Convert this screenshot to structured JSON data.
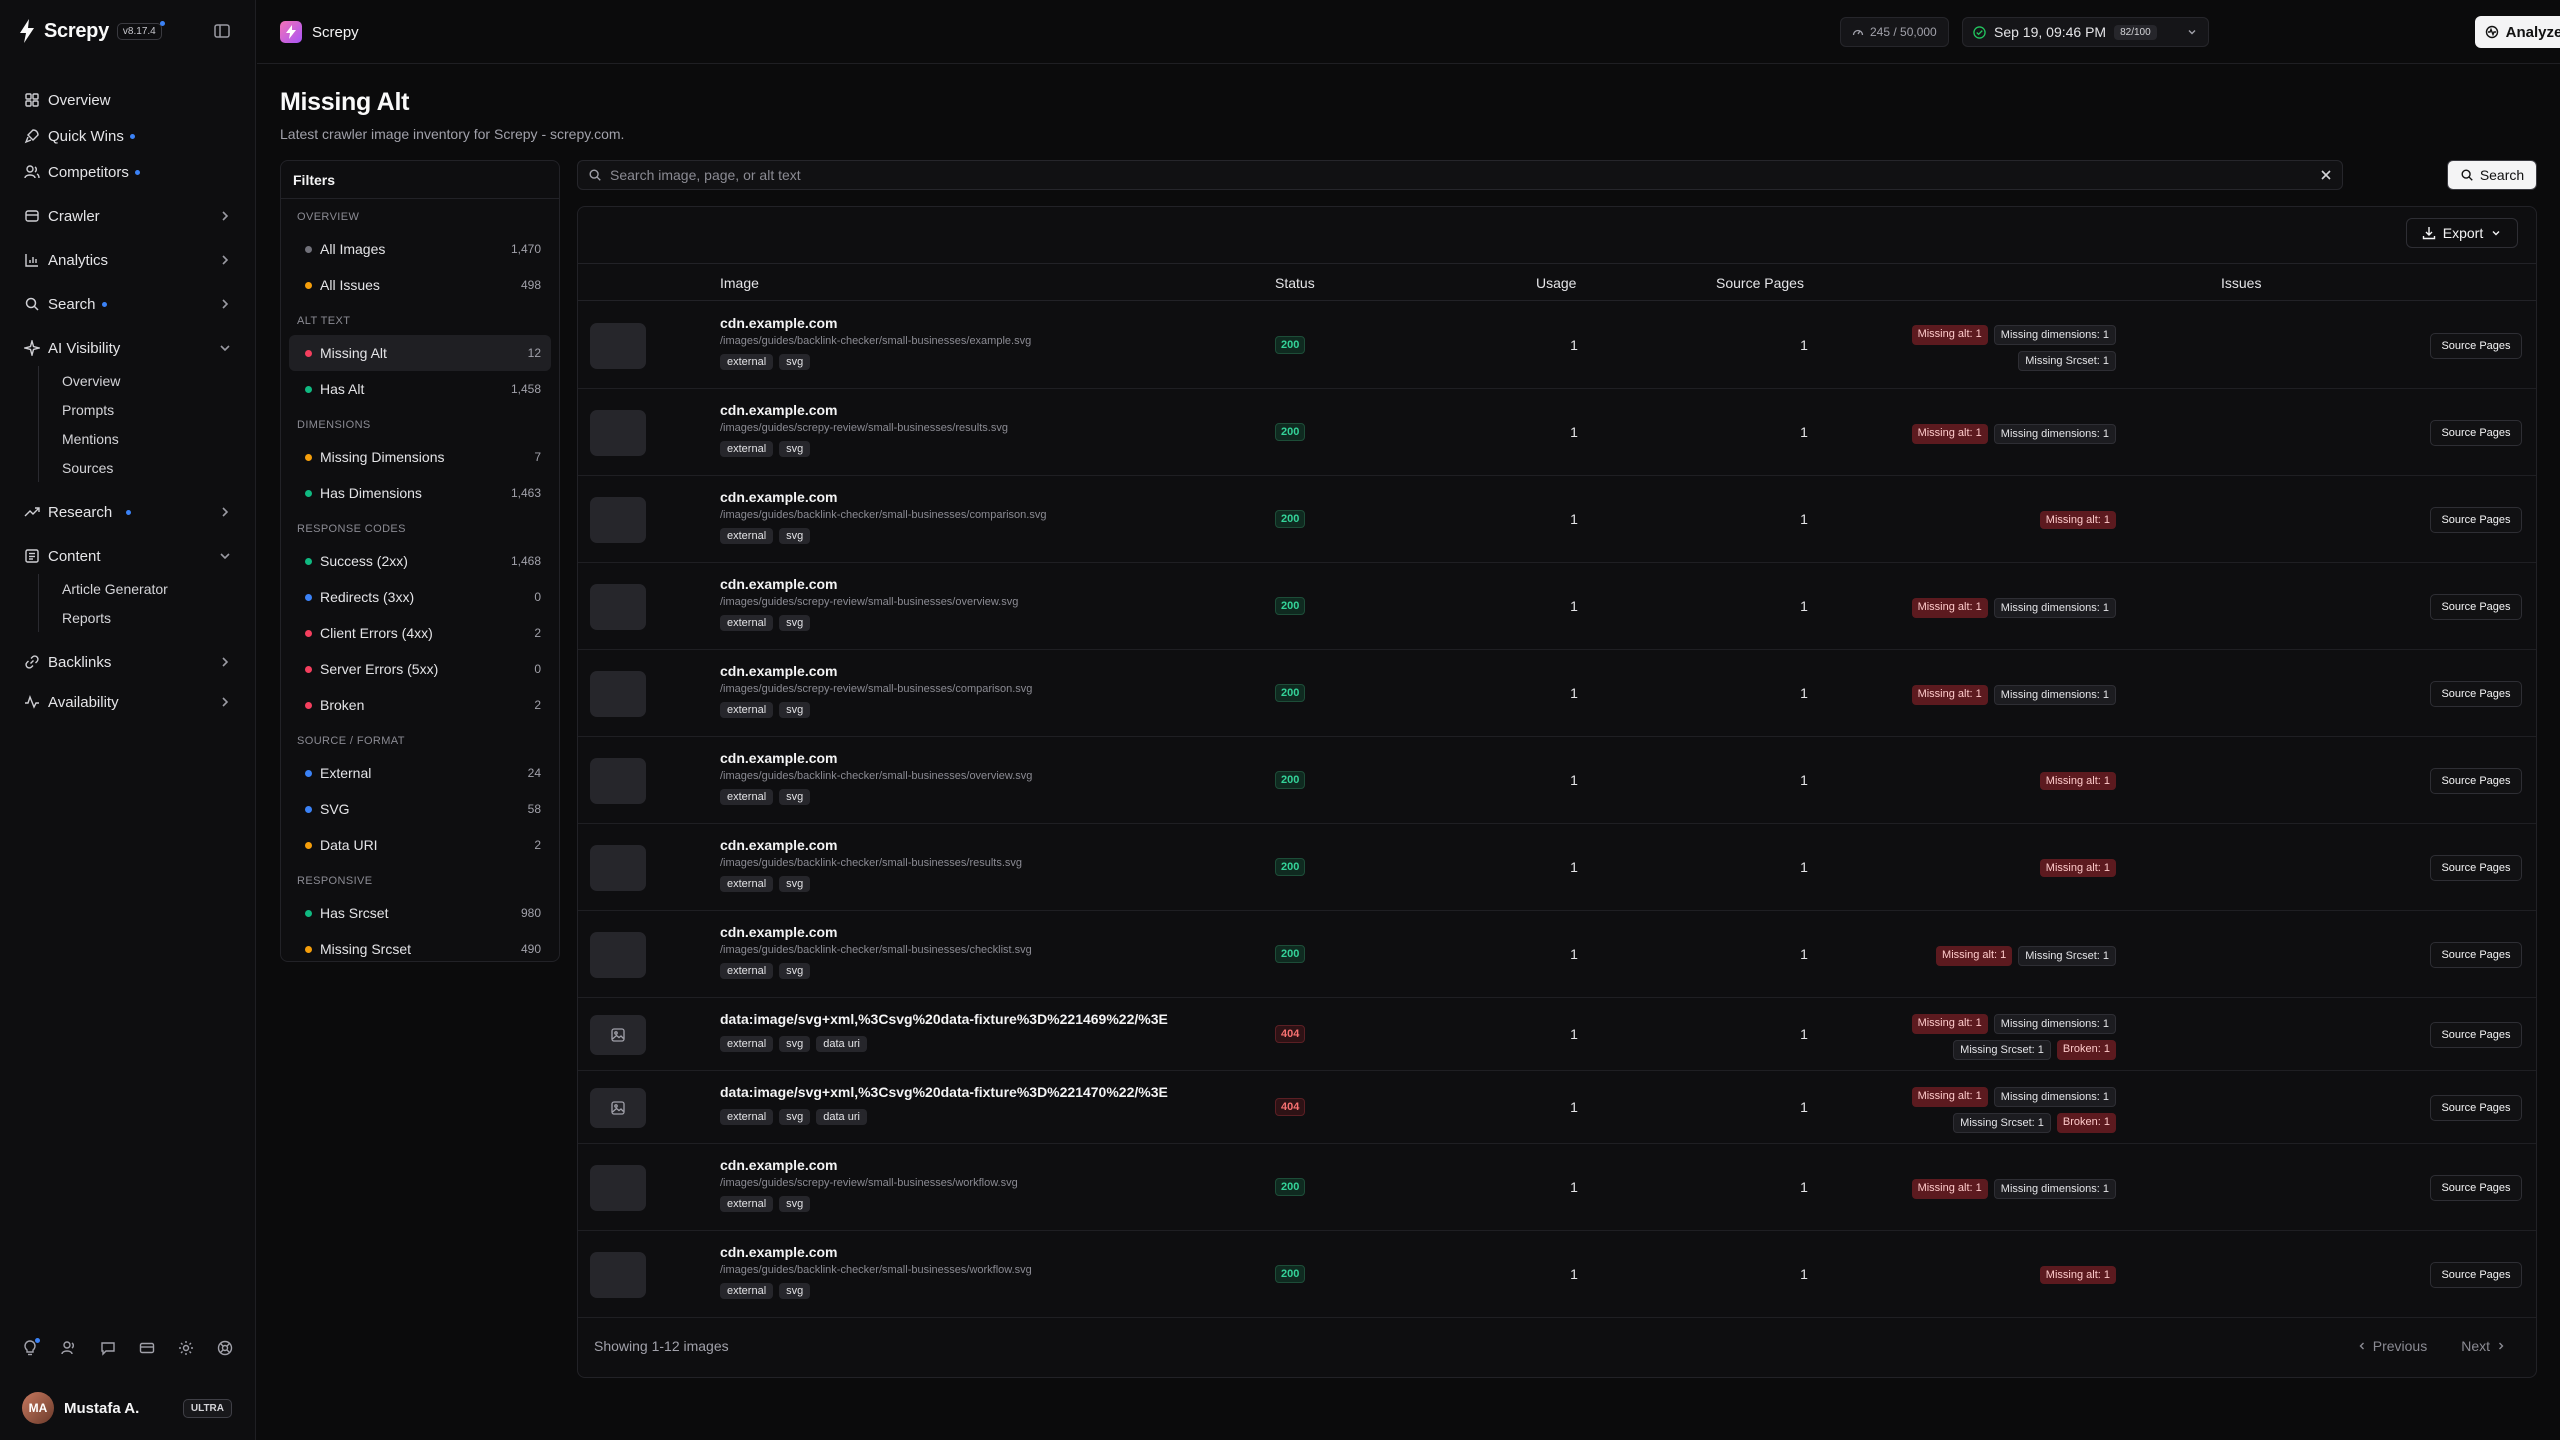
{
  "app": {
    "name": "Screpy",
    "version": "v8.17.4"
  },
  "sidebar": {
    "items": [
      {
        "label": "Overview",
        "icon": "grid-icon"
      },
      {
        "label": "Quick Wins",
        "icon": "rocket-icon",
        "dot": true
      },
      {
        "label": "Competitors",
        "icon": "users-icon",
        "dot": true
      },
      {
        "label": "Crawler",
        "icon": "wallet-icon",
        "chevron": "right"
      },
      {
        "label": "Analytics",
        "icon": "bar-chart-icon",
        "chevron": "right"
      },
      {
        "label": "Search",
        "icon": "search-icon",
        "chevron": "right",
        "dot": true
      },
      {
        "label": "AI Visibility",
        "icon": "sparkle-icon",
        "chevron": "down"
      },
      {
        "label": "Research",
        "icon": "trending-icon",
        "chevron": "right",
        "dot": true
      },
      {
        "label": "Content",
        "icon": "newspaper-icon",
        "chevron": "down"
      },
      {
        "label": "Backlinks",
        "icon": "link-icon",
        "chevron": "right"
      },
      {
        "label": "Availability",
        "icon": "activity-icon",
        "chevron": "right"
      }
    ],
    "ai_visibility_sub": [
      "Overview",
      "Prompts",
      "Mentions",
      "Sources"
    ],
    "content_sub": [
      "Article Generator",
      "Reports"
    ],
    "user": {
      "name": "Mustafa A.",
      "initials": "MA",
      "plan": "ULTRA"
    }
  },
  "topbar": {
    "project": "Screpy",
    "credits": "245 / 50,000",
    "date": "Sep 19, 09:46 PM",
    "score": "82/100",
    "analyze": "Analyze"
  },
  "page": {
    "title": "Missing Alt",
    "subtitle": "Latest crawler image inventory for Screpy - screpy.com."
  },
  "filters": {
    "title": "Filters",
    "groups": [
      {
        "title": "OVERVIEW",
        "items": [
          {
            "label": "All Images",
            "count": "1,470",
            "color": "#71717a"
          },
          {
            "label": "All Issues",
            "count": "498",
            "color": "#f59e0b"
          }
        ]
      },
      {
        "title": "ALT TEXT",
        "items": [
          {
            "label": "Missing Alt",
            "count": "12",
            "color": "#f43f5e",
            "active": true
          },
          {
            "label": "Has Alt",
            "count": "1,458",
            "color": "#10b981"
          }
        ]
      },
      {
        "title": "DIMENSIONS",
        "items": [
          {
            "label": "Missing Dimensions",
            "count": "7",
            "color": "#f59e0b"
          },
          {
            "label": "Has Dimensions",
            "count": "1,463",
            "color": "#10b981"
          }
        ]
      },
      {
        "title": "RESPONSE CODES",
        "items": [
          {
            "label": "Success (2xx)",
            "count": "1,468",
            "color": "#10b981"
          },
          {
            "label": "Redirects (3xx)",
            "count": "0",
            "color": "#3b82f6"
          },
          {
            "label": "Client Errors (4xx)",
            "count": "2",
            "color": "#f43f5e"
          },
          {
            "label": "Server Errors (5xx)",
            "count": "0",
            "color": "#f43f5e"
          },
          {
            "label": "Broken",
            "count": "2",
            "color": "#f43f5e"
          }
        ]
      },
      {
        "title": "SOURCE / FORMAT",
        "items": [
          {
            "label": "External",
            "count": "24",
            "color": "#3b82f6"
          },
          {
            "label": "SVG",
            "count": "58",
            "color": "#3b82f6"
          },
          {
            "label": "Data URI",
            "count": "2",
            "color": "#f59e0b"
          }
        ]
      },
      {
        "title": "RESPONSIVE",
        "items": [
          {
            "label": "Has Srcset",
            "count": "980",
            "color": "#10b981"
          },
          {
            "label": "Missing Srcset",
            "count": "490",
            "color": "#f59e0b"
          }
        ]
      }
    ]
  },
  "search": {
    "placeholder": "Search image, page, or alt text",
    "button": "Search"
  },
  "table": {
    "export": "Export",
    "headers": {
      "image": "Image",
      "status": "Status",
      "usage": "Usage",
      "source_pages": "Source Pages",
      "issues": "Issues"
    },
    "action_label": "Source Pages",
    "rows": [
      {
        "host": "cdn.example.com",
        "path": "/images/guides/backlink-checker/small-businesses/example.svg",
        "tags": [
          "external",
          "svg"
        ],
        "status": "200",
        "usage": "1",
        "pages": "1",
        "issues": [
          [
            "Missing alt: 1",
            "Missing dimensions: 1"
          ],
          [
            "Missing Srcset: 1"
          ]
        ]
      },
      {
        "host": "cdn.example.com",
        "path": "/images/guides/screpy-review/small-businesses/results.svg",
        "tags": [
          "external",
          "svg"
        ],
        "status": "200",
        "usage": "1",
        "pages": "1",
        "issues": [
          [
            "Missing alt: 1",
            "Missing dimensions: 1"
          ]
        ]
      },
      {
        "host": "cdn.example.com",
        "path": "/images/guides/backlink-checker/small-businesses/comparison.svg",
        "tags": [
          "external",
          "svg"
        ],
        "status": "200",
        "usage": "1",
        "pages": "1",
        "issues": [
          [
            "Missing alt: 1"
          ]
        ]
      },
      {
        "host": "cdn.example.com",
        "path": "/images/guides/screpy-review/small-businesses/overview.svg",
        "tags": [
          "external",
          "svg"
        ],
        "status": "200",
        "usage": "1",
        "pages": "1",
        "issues": [
          [
            "Missing alt: 1",
            "Missing dimensions: 1"
          ]
        ]
      },
      {
        "host": "cdn.example.com",
        "path": "/images/guides/screpy-review/small-businesses/comparison.svg",
        "tags": [
          "external",
          "svg"
        ],
        "status": "200",
        "usage": "1",
        "pages": "1",
        "issues": [
          [
            "Missing alt: 1",
            "Missing dimensions: 1"
          ]
        ]
      },
      {
        "host": "cdn.example.com",
        "path": "/images/guides/backlink-checker/small-businesses/overview.svg",
        "tags": [
          "external",
          "svg"
        ],
        "status": "200",
        "usage": "1",
        "pages": "1",
        "issues": [
          [
            "Missing alt: 1"
          ]
        ]
      },
      {
        "host": "cdn.example.com",
        "path": "/images/guides/backlink-checker/small-businesses/results.svg",
        "tags": [
          "external",
          "svg"
        ],
        "status": "200",
        "usage": "1",
        "pages": "1",
        "issues": [
          [
            "Missing alt: 1"
          ]
        ]
      },
      {
        "host": "cdn.example.com",
        "path": "/images/guides/backlink-checker/small-businesses/checklist.svg",
        "tags": [
          "external",
          "svg"
        ],
        "status": "200",
        "usage": "1",
        "pages": "1",
        "issues": [
          [
            "Missing alt: 1",
            "Missing Srcset: 1"
          ]
        ]
      },
      {
        "host": "data:image/svg+xml,%3Csvg%20data-fixture%3D%221469%22/%3E",
        "path": "",
        "tags": [
          "external",
          "svg",
          "data uri"
        ],
        "status": "404",
        "usage": "1",
        "pages": "1",
        "issues": [
          [
            "Missing alt: 1",
            "Missing dimensions: 1"
          ],
          [
            "Missing Srcset: 1",
            "Broken: 1"
          ]
        ]
      },
      {
        "host": "data:image/svg+xml,%3Csvg%20data-fixture%3D%221470%22/%3E",
        "path": "",
        "tags": [
          "external",
          "svg",
          "data uri"
        ],
        "status": "404",
        "usage": "1",
        "pages": "1",
        "issues": [
          [
            "Missing alt: 1",
            "Missing dimensions: 1"
          ],
          [
            "Missing Srcset: 1",
            "Broken: 1"
          ]
        ]
      },
      {
        "host": "cdn.example.com",
        "path": "/images/guides/screpy-review/small-businesses/workflow.svg",
        "tags": [
          "external",
          "svg"
        ],
        "status": "200",
        "usage": "1",
        "pages": "1",
        "issues": [
          [
            "Missing alt: 1",
            "Missing dimensions: 1"
          ]
        ]
      },
      {
        "host": "cdn.example.com",
        "path": "/images/guides/backlink-checker/small-businesses/workflow.svg",
        "tags": [
          "external",
          "svg"
        ],
        "status": "200",
        "usage": "1",
        "pages": "1",
        "issues": [
          [
            "Missing alt: 1"
          ]
        ]
      }
    ],
    "showing": "Showing 1-12 images",
    "previous": "Previous",
    "next": "Next"
  }
}
